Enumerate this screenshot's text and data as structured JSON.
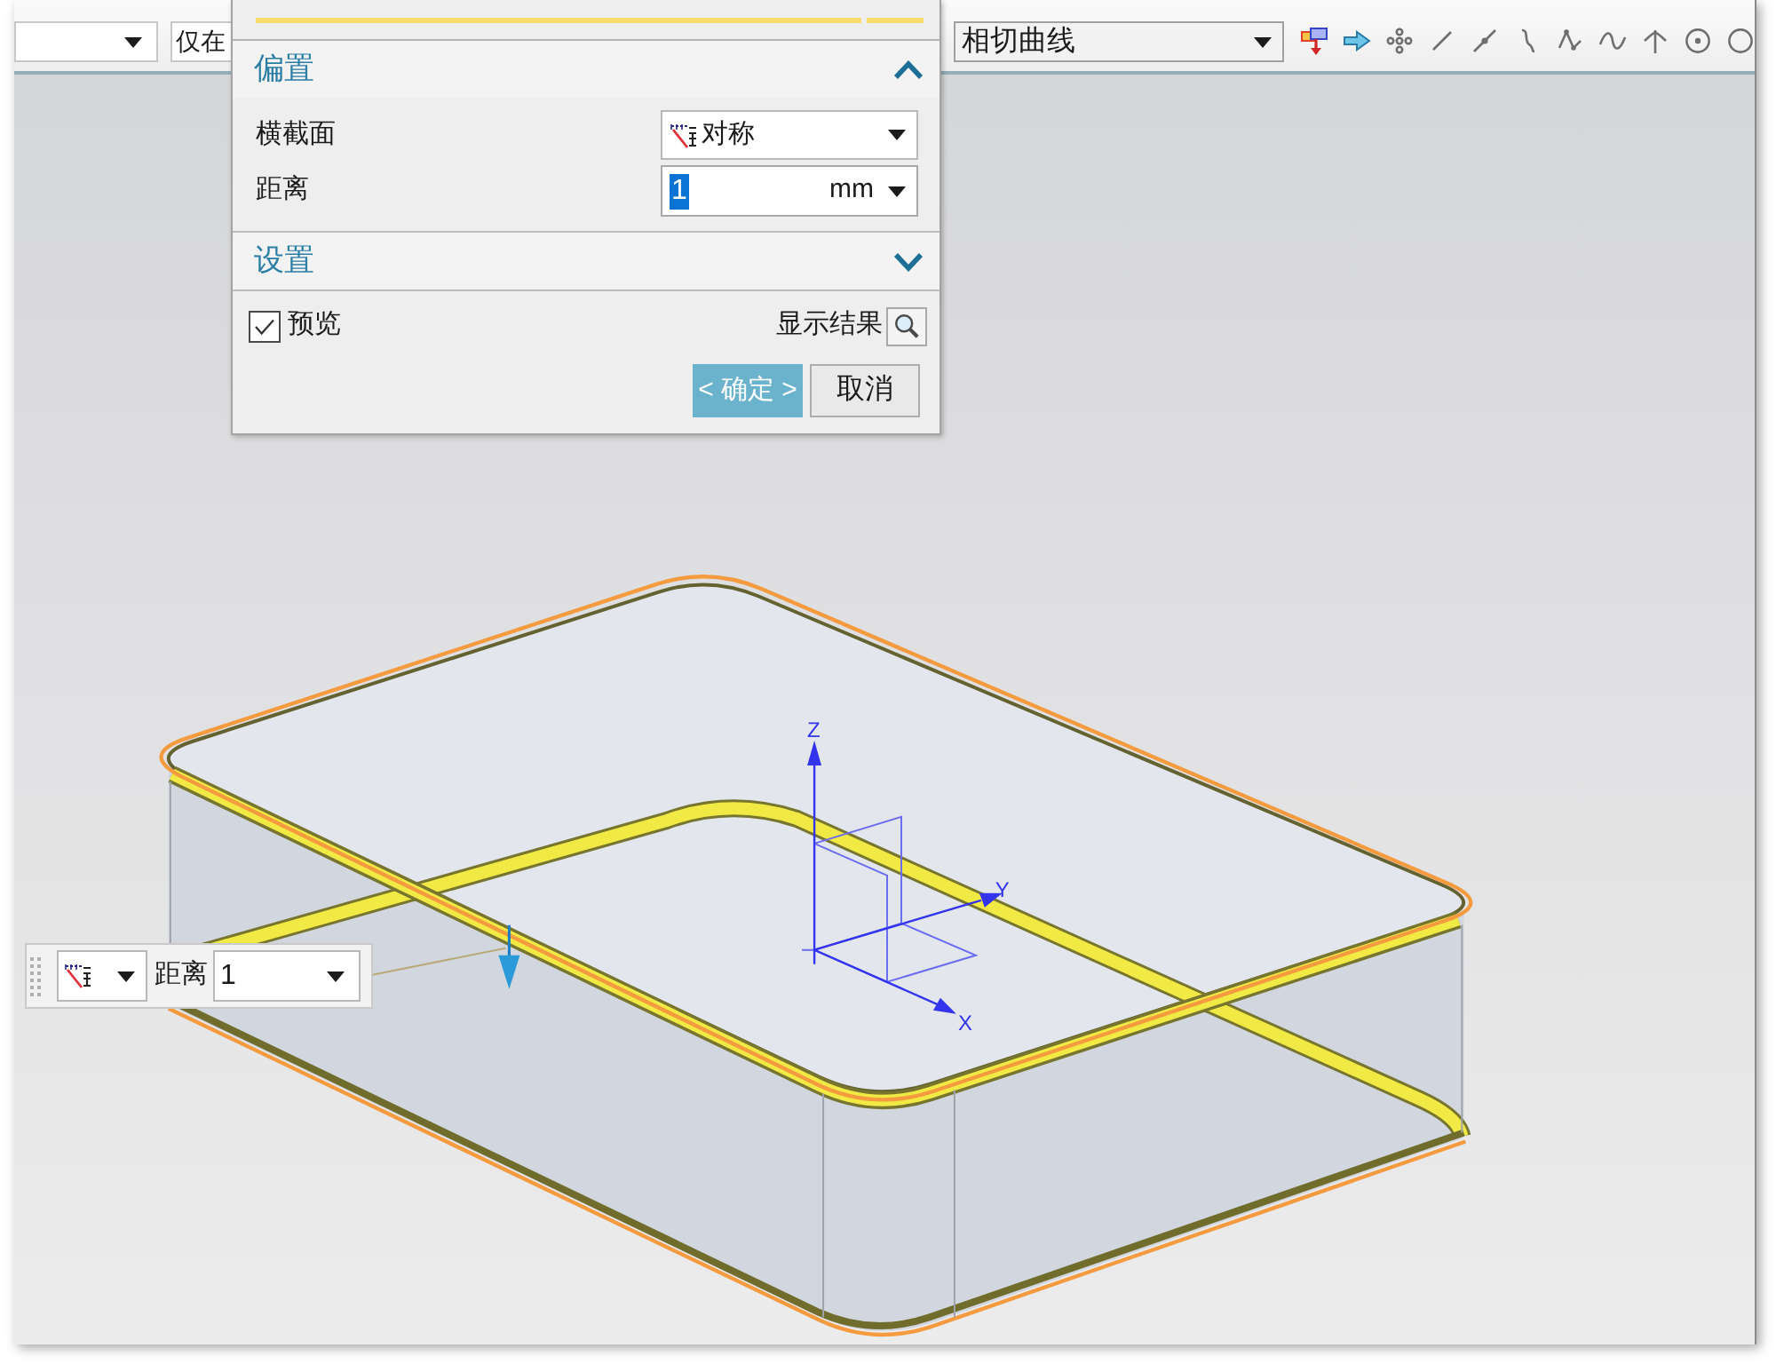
{
  "toolbar": {
    "filter_field": {
      "value": "仅在"
    },
    "curve_type_dropdown": {
      "value": "相切曲线"
    }
  },
  "dialog": {
    "sections": [
      {
        "title": "偏置",
        "expanded": true,
        "rows": [
          {
            "kind": "dropdown",
            "label": "横截面",
            "value": "对称"
          },
          {
            "kind": "input",
            "label": "距离",
            "value": "1",
            "value_selected": true,
            "unit": "mm"
          }
        ]
      },
      {
        "title": "设置",
        "expanded": false
      }
    ],
    "preview": {
      "label": "预览",
      "checked": true
    },
    "show_result": {
      "label": "显示结果"
    },
    "buttons": [
      {
        "kind": "primary",
        "label": "< 确定 >"
      },
      {
        "kind": "secondary",
        "label": "取消"
      }
    ]
  },
  "floating_input": {
    "label": "距离",
    "value": "1"
  },
  "axes": {
    "z_label": "Z",
    "y_label": "Y",
    "x_label": "X"
  }
}
